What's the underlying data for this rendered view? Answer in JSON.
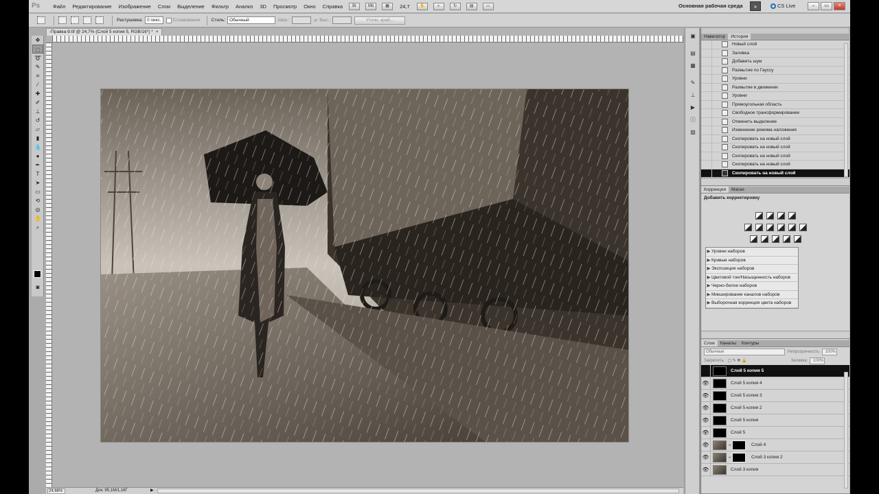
{
  "menubar": {
    "logo": "Ps",
    "items": [
      "Файл",
      "Редактирование",
      "Изображение",
      "Слои",
      "Выделение",
      "Фильтр",
      "Анализ",
      "3D",
      "Просмотр",
      "Окно",
      "Справка"
    ],
    "zoom": "24,7",
    "workspace": "Основная рабочая среда",
    "cs_live": "CS Live"
  },
  "options": {
    "feather_label": "Растушевка:",
    "feather_value": "0 пикс.",
    "antialias_label": "Сглаживание",
    "style_label": "Стиль:",
    "style_value": "Обычный",
    "width_label": "Шир.:",
    "height_label": "Выс.:",
    "refine_label": "Уточн. край..."
  },
  "document": {
    "tab_title": "-Правка-9.tif @ 24,7% (Слой 5 копия 5, RGB/16*) *",
    "close": "×"
  },
  "status": {
    "zoom": "24,66%",
    "doc_size": "Док: 95,1M/1,16Г"
  },
  "history": {
    "tabs": [
      "Навигатор",
      "История"
    ],
    "active_tab": 1,
    "items": [
      "Новый слой",
      "Заливка",
      "Добавить шум",
      "Размытие по Гауссу",
      "Уровни",
      "Размытие в движении",
      "Уровни",
      "Прямоугольная область",
      "Свободное трансформирование",
      "Отменить выделение",
      "Изменение режима наложения",
      "Скопировать на новый слой",
      "Скопировать на новый слой",
      "Скопировать на новый слой",
      "Скопировать на новый слой",
      "Скопировать на новый слой"
    ],
    "selected_index": 15
  },
  "adjustments": {
    "tabs": [
      "Коррекция",
      "Маски"
    ],
    "active_tab": 0,
    "title": "Добавить корректировку",
    "presets": [
      "Уровни наборов",
      "Кривые наборов",
      "Экспозиция наборов",
      "Цветовой тон/Насыщенность наборов",
      "Черно-белое наборов",
      "Микширование каналов наборов",
      "Выборочная коррекция цвета наборов"
    ]
  },
  "layers": {
    "tabs": [
      "Слои",
      "Каналы",
      "Контуры"
    ],
    "active_tab": 0,
    "blend_mode": "Обычные",
    "opacity_label": "Непрозрачность:",
    "opacity": "100%",
    "lock_label": "Закрепить:",
    "fill_label": "Заливка:",
    "fill": "100%",
    "items": [
      {
        "name": "Слой 5 копия 5",
        "selected": true,
        "visible": false,
        "photo": false,
        "mask": false
      },
      {
        "name": "Слой 5 копия 4",
        "selected": false,
        "visible": true,
        "photo": false,
        "mask": false
      },
      {
        "name": "Слой 5 копия 3",
        "selected": false,
        "visible": true,
        "photo": false,
        "mask": false
      },
      {
        "name": "Слой 5 копия 2",
        "selected": false,
        "visible": true,
        "photo": false,
        "mask": false
      },
      {
        "name": "Слой 5 копия",
        "selected": false,
        "visible": true,
        "photo": false,
        "mask": false
      },
      {
        "name": "Слой 5",
        "selected": false,
        "visible": true,
        "photo": false,
        "mask": false
      },
      {
        "name": "Слой 4",
        "selected": false,
        "visible": true,
        "photo": true,
        "mask": true
      },
      {
        "name": "Слой 3 копия 2",
        "selected": false,
        "visible": true,
        "photo": true,
        "mask": true
      },
      {
        "name": "Слой 3 копия",
        "selected": false,
        "visible": true,
        "photo": true,
        "mask": false
      }
    ]
  },
  "colors": {
    "ui_bg": "#ababab",
    "panel_bg": "#d4d4d4",
    "selection": "#111111",
    "photo_tone": "#5a5148"
  }
}
